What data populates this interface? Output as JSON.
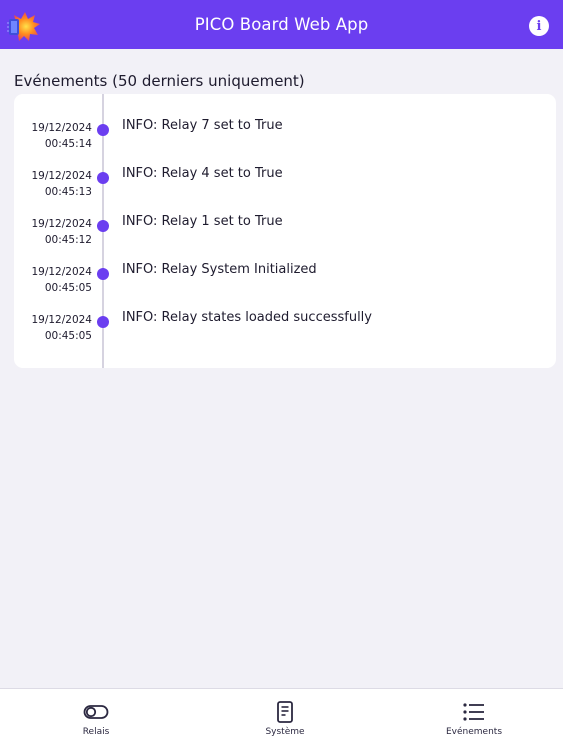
{
  "header": {
    "title": "PICO Board Web App",
    "info_icon": "info-icon",
    "info_glyph": "i",
    "accent_color": "#6b3ef0"
  },
  "events_section": {
    "title": "Evénements (50 derniers uniquement)",
    "items": [
      {
        "date": "19/12/2024",
        "time": "00:45:14",
        "message": "INFO: Relay 7 set to True"
      },
      {
        "date": "19/12/2024",
        "time": "00:45:13",
        "message": "INFO: Relay 4 set to True"
      },
      {
        "date": "19/12/2024",
        "time": "00:45:12",
        "message": "INFO: Relay 1 set to True"
      },
      {
        "date": "19/12/2024",
        "time": "00:45:05",
        "message": "INFO: Relay System Initialized"
      },
      {
        "date": "19/12/2024",
        "time": "00:45:05",
        "message": "INFO: Relay states loaded successfully"
      }
    ]
  },
  "bottom_nav": {
    "items": [
      {
        "label": "Relais",
        "icon": "toggle-icon"
      },
      {
        "label": "Système",
        "icon": "document-icon"
      },
      {
        "label": "Evénements",
        "icon": "list-icon"
      }
    ]
  }
}
